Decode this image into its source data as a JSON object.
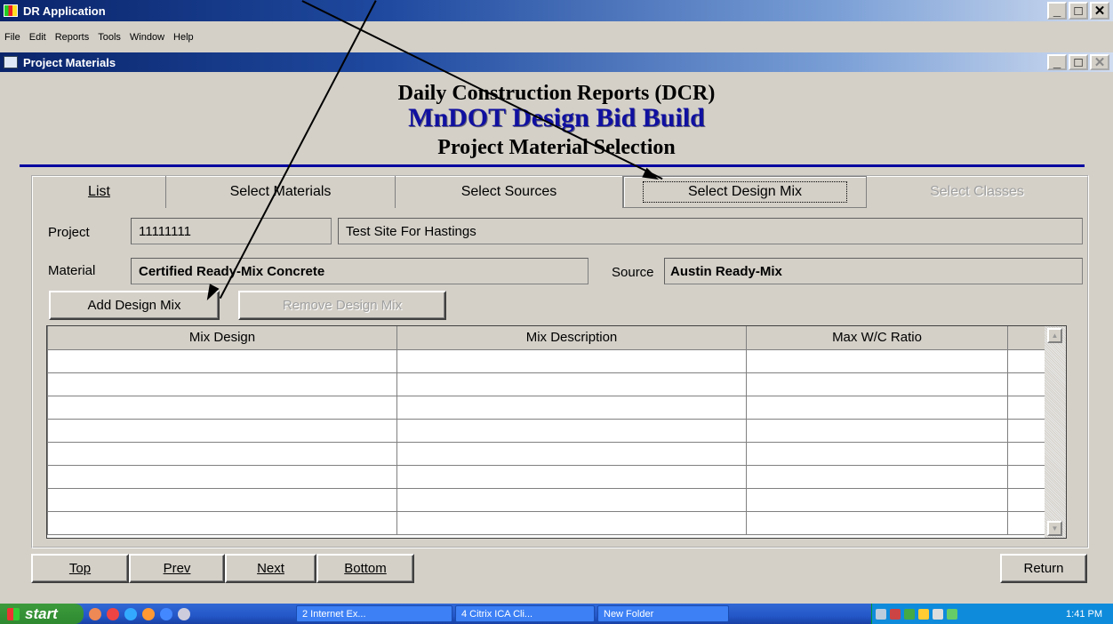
{
  "app": {
    "title": "DR Application",
    "menu": [
      "File",
      "Edit",
      "Reports",
      "Tools",
      "Window",
      "Help"
    ]
  },
  "child": {
    "title": "Project Materials"
  },
  "header": {
    "line1": "Daily Construction Reports (DCR)",
    "line2": "MnDOT Design Bid Build",
    "line3": "Project Material Selection"
  },
  "tabs": [
    {
      "label": "List",
      "state": "normal"
    },
    {
      "label": "Select Materials",
      "state": "normal"
    },
    {
      "label": "Select Sources",
      "state": "normal"
    },
    {
      "label": "Select Design Mix",
      "state": "selected"
    },
    {
      "label": "Select Classes",
      "state": "disabled"
    }
  ],
  "form": {
    "project_label": "Project",
    "project_id": "11111111",
    "project_name": "Test Site For Hastings",
    "material_label": "Material",
    "material_value": "Certified Ready-Mix Concrete",
    "source_label": "Source",
    "source_value": "Austin Ready-Mix"
  },
  "buttons": {
    "add": "Add Design Mix",
    "remove": "Remove Design Mix"
  },
  "grid": {
    "columns": [
      "Mix Design",
      "Mix Description",
      "Max W/C Ratio"
    ],
    "rows": []
  },
  "nav": {
    "top": "Top",
    "prev": "Prev",
    "next": "Next",
    "bottom": "Bottom",
    "return": "Return"
  },
  "taskbar": {
    "start": "start",
    "items": [
      "2 Internet Ex...",
      "4 Citrix ICA Cli...",
      "New Folder"
    ],
    "clock": "1:41 PM"
  }
}
